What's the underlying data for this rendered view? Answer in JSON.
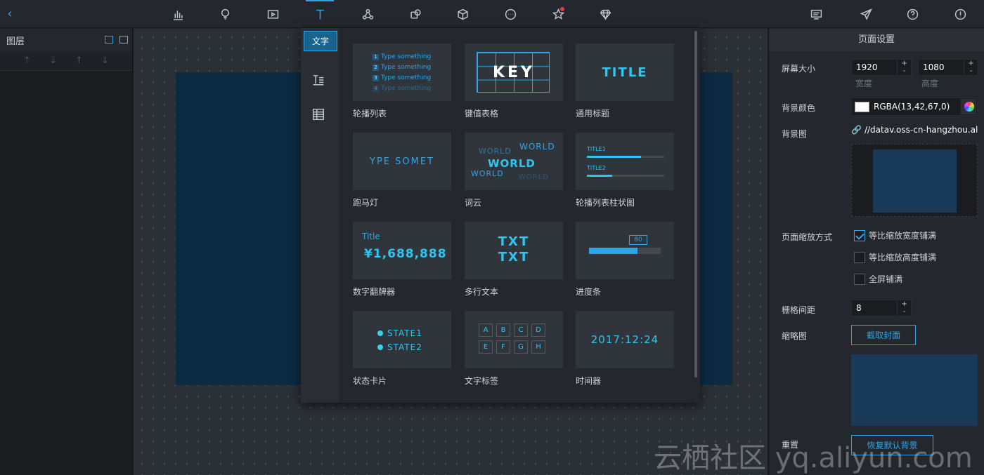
{
  "topbar": {
    "back_icon": "chevron-left-icon",
    "icons": [
      "bar-chart-icon",
      "map-pin-icon",
      "media-icon",
      "text-icon",
      "network-icon",
      "layers-icon",
      "cube-icon",
      "more-icon",
      "favorite-icon",
      "gem-icon"
    ],
    "right_icons": [
      "message-icon",
      "send-icon",
      "help-icon",
      "info-icon"
    ],
    "active_icon": "text-icon",
    "notification_color": "#e93a3a"
  },
  "layers": {
    "title": "图层",
    "tools": [
      "move-top-icon",
      "move-bottom-icon",
      "move-up-icon",
      "move-down-icon"
    ]
  },
  "popup": {
    "category": "文字",
    "side_icons": [
      "text-list-icon",
      "table-icon"
    ],
    "cards": [
      {
        "label": "轮播列表",
        "thumb": {
          "rows": [
            [
              "1",
              "Type something"
            ],
            [
              "2",
              "Type something"
            ],
            [
              "3",
              "Type something"
            ],
            [
              "4",
              "Type something"
            ]
          ]
        }
      },
      {
        "label": "键值表格",
        "thumb": {
          "text": "KEY"
        }
      },
      {
        "label": "通用标题",
        "thumb": {
          "text": "TITLE"
        }
      },
      {
        "label": "跑马灯",
        "thumb": {
          "text": "YPE SOMET"
        }
      },
      {
        "label": "词云",
        "thumb": {
          "words": [
            "WORLD",
            "WORLD",
            "WORLD",
            "WORLD",
            "WORLD"
          ]
        }
      },
      {
        "label": "轮播列表柱状图",
        "thumb": {
          "items": [
            {
              "label": "TITLE1",
              "value": 0.7
            },
            {
              "label": "TITLE2",
              "value": 0.33
            }
          ]
        }
      },
      {
        "label": "数字翻牌器",
        "thumb": {
          "title": "Title",
          "value": "¥1,688,888"
        }
      },
      {
        "label": "多行文本",
        "thumb": {
          "lines": [
            "TXT",
            "TXT"
          ]
        }
      },
      {
        "label": "进度条",
        "thumb": {
          "value": "80",
          "progress": 0.68
        }
      },
      {
        "label": "状态卡片",
        "thumb": {
          "states": [
            "STATE1",
            "STATE2"
          ]
        }
      },
      {
        "label": "文字标签",
        "thumb": {
          "tags": [
            "A",
            "B",
            "C",
            "D",
            "E",
            "F",
            "G",
            "H"
          ]
        }
      },
      {
        "label": "时间器",
        "thumb": {
          "text": "2017:12:24"
        }
      }
    ]
  },
  "settings": {
    "title": "页面设置",
    "screen_size_label": "屏幕大小",
    "width": "1920",
    "height": "1080",
    "width_label": "宽度",
    "height_label": "高度",
    "bg_color_label": "背景颜色",
    "bg_color_value": "RGBA(13,42,67,0)",
    "bg_image_label": "背景图",
    "bg_image_url": "//datav.oss-cn-hangzhou.ali",
    "zoom_label": "页面缩放方式",
    "zoom_options": [
      {
        "label": "等比缩放宽度铺满",
        "checked": true
      },
      {
        "label": "等比缩放高度铺满",
        "checked": false
      },
      {
        "label": "全屏铺满",
        "checked": false
      }
    ],
    "grid_label": "栅格间距",
    "grid_value": "8",
    "thumbnail_label": "缩略图",
    "capture_button": "截取封面",
    "reset_label": "重置",
    "reset_button": "恢复默认背景"
  },
  "colors": {
    "accent": "#2ea6e6",
    "canvas_screen": "#0d2a43",
    "panel": "#24272d"
  },
  "watermark": "云栖社区 yq.aliyun.com"
}
